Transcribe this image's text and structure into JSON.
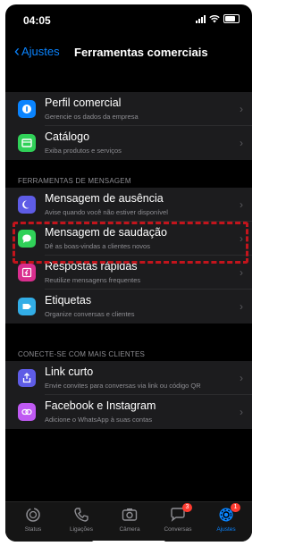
{
  "status": {
    "time": "04:05"
  },
  "nav": {
    "back_label": "Ajustes",
    "title": "Ferramentas comerciais"
  },
  "group1": [
    {
      "title": "Perfil comercial",
      "subtitle": "Gerencie os dados da empresa",
      "icon": "store-icon",
      "color": "#0a84ff"
    },
    {
      "title": "Catálogo",
      "subtitle": "Exiba produtos e serviços",
      "icon": "catalog-icon",
      "color": "#30d158"
    }
  ],
  "section2": {
    "header": "FERRAMENTAS DE MENSAGEM"
  },
  "group2": [
    {
      "title": "Mensagem de ausência",
      "subtitle": "Avise quando você não estiver disponível",
      "icon": "moon-icon",
      "color": "#5e5ce6"
    },
    {
      "title": "Mensagem de saudação",
      "subtitle": "Dê as boas-vindas a clientes novos",
      "icon": "chat-bubble-icon",
      "color": "#30d158"
    },
    {
      "title": "Respostas rápidas",
      "subtitle": "Reutilize mensagens frequentes",
      "icon": "quick-reply-icon",
      "color": "#d92e8e"
    },
    {
      "title": "Etiquetas",
      "subtitle": "Organize conversas e clientes",
      "icon": "label-icon",
      "color": "#32ade6"
    }
  ],
  "section3": {
    "header": "CONECTE-SE COM MAIS CLIENTES"
  },
  "group3": [
    {
      "title": "Link curto",
      "subtitle": "Envie convites para conversas via link ou código QR",
      "icon": "share-icon",
      "color": "#5e5ce6"
    },
    {
      "title": "Facebook e Instagram",
      "subtitle": "Adicione o WhatsApp à suas contas",
      "icon": "link-icon",
      "color": "#bf5af2"
    }
  ],
  "tabbar": [
    {
      "label": "Status",
      "icon": "status-icon"
    },
    {
      "label": "Ligações",
      "icon": "phone-icon"
    },
    {
      "label": "Câmera",
      "icon": "camera-icon"
    },
    {
      "label": "Conversas",
      "icon": "chats-icon",
      "badge": "3"
    },
    {
      "label": "Ajustes",
      "icon": "settings-icon",
      "badge": "1",
      "active": true
    }
  ],
  "colors": {
    "accent": "#0a84ff",
    "highlight": "#c3141c",
    "badge": "#ff3b30"
  }
}
